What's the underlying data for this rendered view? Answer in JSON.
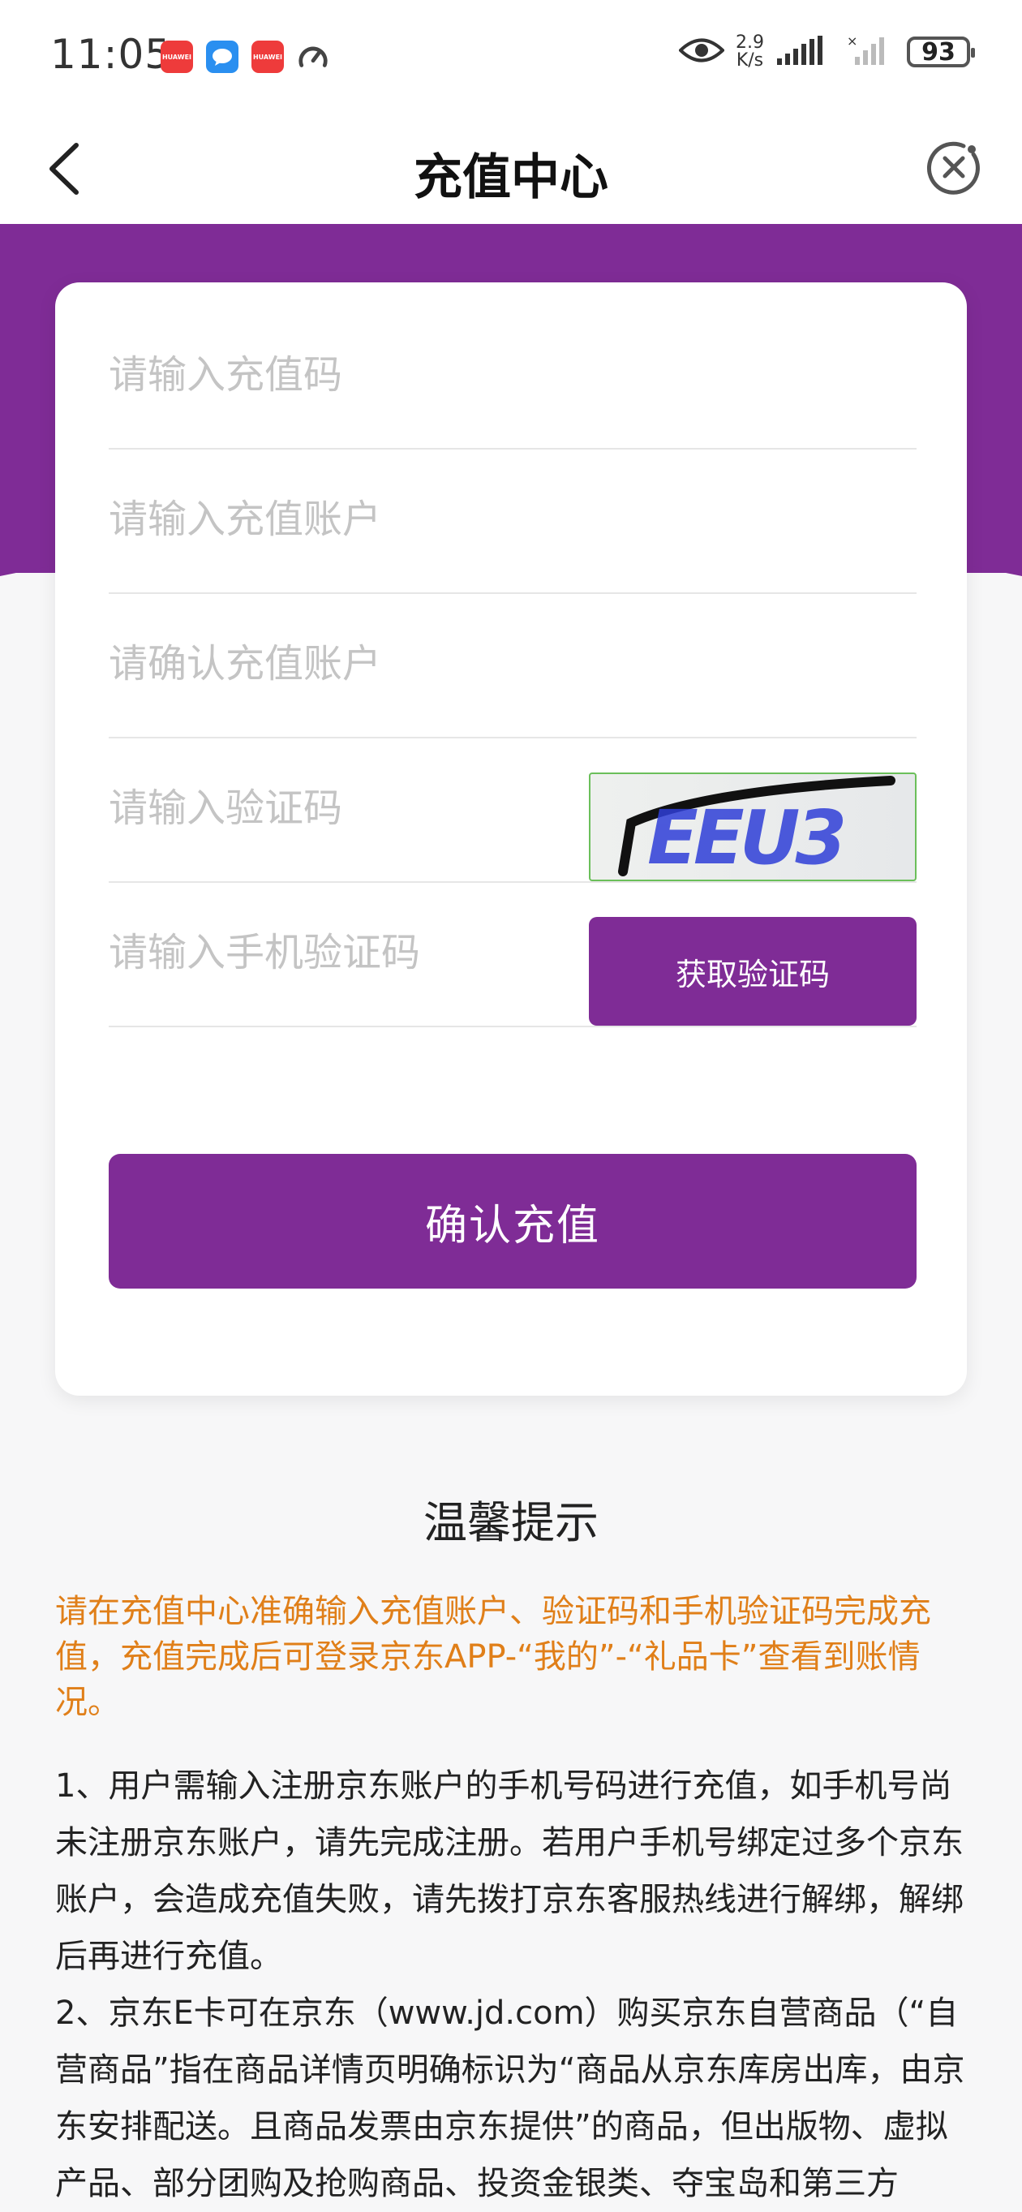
{
  "status_bar": {
    "time": "11:05",
    "app_icon_labels": [
      "HUAWEI",
      "HUAWEI"
    ],
    "net_speed_value": "2.9",
    "net_speed_unit": "K/s",
    "battery": "93"
  },
  "navbar": {
    "title": "充值中心"
  },
  "form": {
    "recharge_code_placeholder": "请输入充值码",
    "account_placeholder": "请输入充值账户",
    "confirm_account_placeholder": "请确认充值账户",
    "captcha_placeholder": "请输入验证码",
    "captcha_image_text": "EEU3",
    "sms_code_placeholder": "请输入手机验证码",
    "get_code_label": "获取验证码",
    "confirm_label": "确认充值"
  },
  "tips": {
    "title": "温馨提示",
    "highlight": "请在充值中心准确输入充值账户、验证码和手机验证码完成充值，充值完成后可登录京东APP-“我的”-“礼品卡”查看到账情况。",
    "items": [
      "1、用户需输入注册京东账户的手机号码进行充值，如手机号尚未注册京东账户，请先完成注册。若用户手机号绑定过多个京东账户，会造成充值失败，请先拨打京东客服热线进行解绑，解绑后再进行充值。",
      "2、京东E卡可在京东（www.jd.com）购买京东自营商品（“自营商品”指在商品详情页明确标识为“商品从京东库房出库，由京东安排配送。且商品发票由京东提供”的商品，但出版物、虚拟产品、部分团购及抢购商品、投资金银类、夺宝岛和第三方"
    ]
  },
  "colors": {
    "brand_purple": "#7f2c96",
    "tip_orange": "#e07f19",
    "captcha_border": "#6bbf5a"
  },
  "icons": {
    "back": "chevron-left-icon",
    "close": "close-circle-icon",
    "eye": "eye-icon",
    "signal": "signal-icon",
    "battery": "battery-icon"
  }
}
